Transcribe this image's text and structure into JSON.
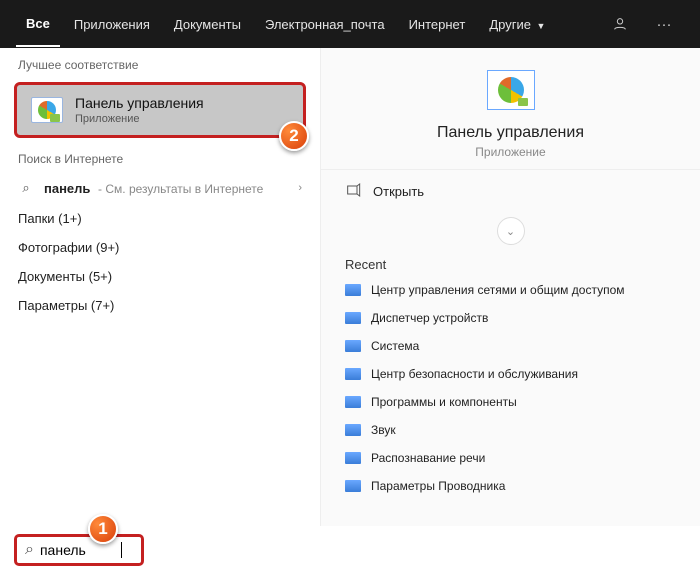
{
  "topbar": {
    "tabs": [
      "Все",
      "Приложения",
      "Документы",
      "Электронная_почта",
      "Интернет"
    ],
    "more": "Другие"
  },
  "left": {
    "best_match_header": "Лучшее соответствие",
    "best_match": {
      "title": "Панель управления",
      "subtitle": "Приложение"
    },
    "web_header": "Поиск в Интернете",
    "web_item": {
      "term": "панель",
      "suffix": "- См. результаты в Интернете"
    },
    "categories": [
      "Папки (1+)",
      "Фотографии (9+)",
      "Документы (5+)",
      "Параметры (7+)"
    ]
  },
  "right": {
    "title": "Панель управления",
    "subtitle": "Приложение",
    "open": "Открыть",
    "recent_header": "Recent",
    "recent": [
      "Центр управления сетями и общим доступом",
      "Диспетчер устройств",
      "Система",
      "Центр безопасности и обслуживания",
      "Программы и компоненты",
      "Звук",
      "Распознавание речи",
      "Параметры Проводника"
    ]
  },
  "search": {
    "value": "панель"
  },
  "annotations": {
    "step1": "1",
    "step2": "2"
  }
}
